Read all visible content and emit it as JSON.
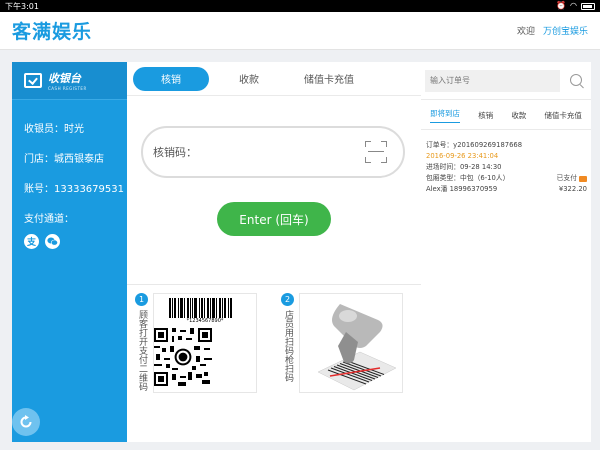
{
  "status_bar": {
    "time": "下午3:01"
  },
  "header": {
    "logo": "客满娱乐",
    "welcome": "欢迎",
    "user": "万创宝娱乐"
  },
  "sidebar": {
    "brand_title": "收银台",
    "brand_sub": "CASH REGISTER",
    "cashier": "收银员：时光",
    "store": "门店：城西银泰店",
    "account": "账号：13333679531",
    "pay_channel": "支付通道："
  },
  "tabs": [
    "核销",
    "收款",
    "储值卡充值"
  ],
  "verify": {
    "label": "核销码：",
    "enter_button": "Enter (回车)"
  },
  "guide": {
    "step1_num": "1",
    "step1_text": "顾客打开支付二维码",
    "barcode_number": "*1234567890*",
    "step2_num": "2",
    "step2_text": "店员用扫码枪扫码"
  },
  "right": {
    "search_placeholder": "输入订单号",
    "tabs": [
      "即将到店",
      "核销",
      "收款",
      "储值卡充值"
    ],
    "order": {
      "order_no": "订单号：y201609269187668",
      "time": "2016-09-26 23:41:04",
      "arrival": "进场时间：09-28 14:30",
      "room": "包厢类型：中包（6-10人）",
      "paid": "已支付",
      "customer": "Alex潘 18996370959",
      "price": "¥322.20"
    }
  },
  "colors": {
    "brand": "#1a9be0",
    "enter": "#3fb54a",
    "time": "#e89a1d"
  }
}
